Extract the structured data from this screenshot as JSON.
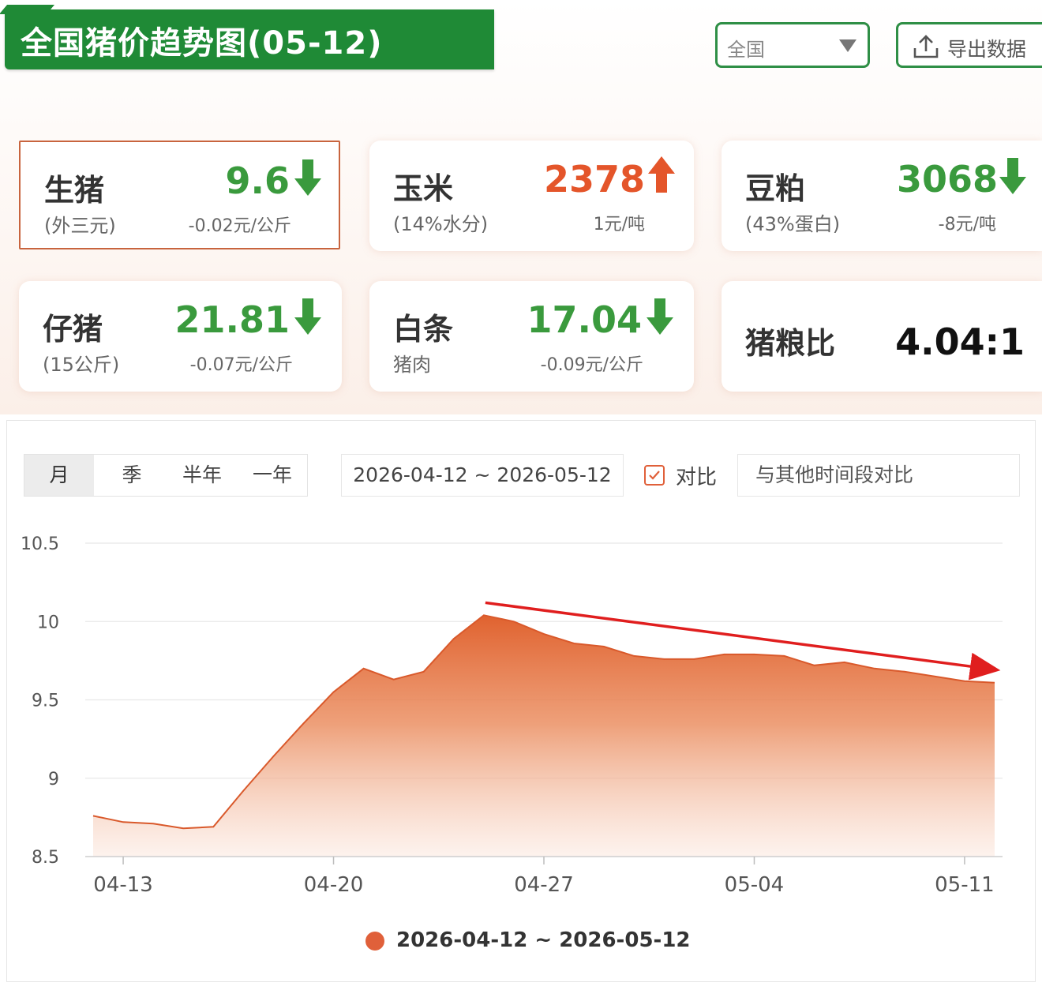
{
  "header": {
    "title": "全国猪价趋势图(05-12)",
    "region_value": "全国",
    "export_label": "导出数据"
  },
  "cards": [
    {
      "name": "生猪",
      "sub": "(外三元)",
      "value": "9.6",
      "change": "-0.02元/公斤",
      "trend": "down"
    },
    {
      "name": "玉米",
      "sub": "(14%水分)",
      "value": "2378",
      "change": "1元/吨",
      "trend": "up"
    },
    {
      "name": "豆粕",
      "sub": "(43%蛋白)",
      "value": "3068",
      "change": "-8元/吨",
      "trend": "down"
    },
    {
      "name": "仔猪",
      "sub": "(15公斤)",
      "value": "21.81",
      "change": "-0.07元/公斤",
      "trend": "down"
    },
    {
      "name": "白条",
      "sub": "猪肉",
      "value": "17.04",
      "change": "-0.09元/公斤",
      "trend": "down"
    },
    {
      "name": "猪粮比",
      "sub": "",
      "value": "4.04:1",
      "change": "",
      "trend": "none"
    }
  ],
  "controls": {
    "tabs": [
      "月",
      "季",
      "半年",
      "一年"
    ],
    "active_tab": "月",
    "date_range": "2026-04-12 ~ 2026-05-12",
    "compare_label": "对比",
    "compare_checked": true,
    "compare_placeholder": "与其他时间段对比"
  },
  "colors": {
    "brand_green": "#1f8a36",
    "down_green": "#3a9a3d",
    "up_orange": "#e4552a",
    "series_orange": "#e0603a",
    "trend_arrow_red": "#e01e1e"
  },
  "chart_data": {
    "type": "area",
    "x_tick_labels": [
      "04-13",
      "04-20",
      "04-27",
      "05-04",
      "05-11"
    ],
    "y_tick_labels": [
      "10.5",
      "10",
      "9.5",
      "9",
      "8.5"
    ],
    "ylim": [
      8.5,
      10.5
    ],
    "grid": true,
    "legend_position": "bottom",
    "series": [
      {
        "name": "2026-04-12 ~ 2026-05-12",
        "x": [
          "04-12",
          "04-13",
          "04-14",
          "04-15",
          "04-16",
          "04-17",
          "04-18",
          "04-19",
          "04-20",
          "04-21",
          "04-22",
          "04-23",
          "04-24",
          "04-25",
          "04-26",
          "04-27",
          "04-28",
          "04-29",
          "04-30",
          "05-01",
          "05-02",
          "05-03",
          "05-04",
          "05-05",
          "05-06",
          "05-07",
          "05-08",
          "05-09",
          "05-10",
          "05-11",
          "05-12"
        ],
        "values": [
          8.76,
          8.72,
          8.71,
          8.68,
          8.69,
          8.92,
          9.14,
          9.35,
          9.55,
          9.7,
          9.63,
          9.68,
          9.89,
          10.04,
          10.0,
          9.92,
          9.86,
          9.84,
          9.78,
          9.76,
          9.76,
          9.79,
          9.79,
          9.78,
          9.72,
          9.74,
          9.7,
          9.68,
          9.65,
          9.62,
          9.61
        ]
      }
    ],
    "annotation": {
      "type": "trend-arrow",
      "from": [
        "04-25",
        10.12
      ],
      "to": [
        "05-12",
        9.7
      ]
    }
  }
}
